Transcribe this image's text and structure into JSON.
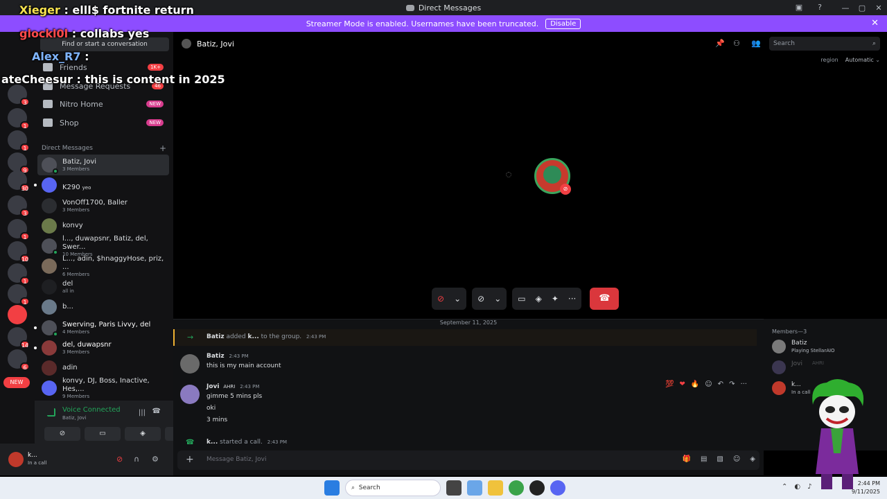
{
  "window": {
    "title": "Direct Messages"
  },
  "banner": {
    "text": "Streamer Mode is enabled. Usernames have been truncated.",
    "button": "Disable"
  },
  "stream_chat": [
    {
      "name": "Xieger",
      "text": ": elll$ fortnite return"
    },
    {
      "name": "glockl0l",
      "text": ": collabs yes"
    },
    {
      "name": "Alex_R7",
      "text": ":"
    },
    {
      "name": "ateCheesur",
      "text": ": this is content in 2025"
    }
  ],
  "servers": {
    "badges": [
      "3",
      "1",
      "1",
      "9",
      "30",
      "3",
      "1",
      "10",
      "1",
      "1",
      "14",
      "6"
    ],
    "new_label": "NEW"
  },
  "sidebar": {
    "find": "Find or start a conversation",
    "nav": [
      {
        "label": "Friends",
        "pill": "1K+"
      },
      {
        "label": "Message Requests",
        "pill": "46"
      },
      {
        "label": "Nitro Home",
        "pill": "NEW"
      },
      {
        "label": "Shop",
        "pill": "NEW"
      }
    ],
    "dm_header": "Direct Messages",
    "dms": [
      {
        "name": "Batiz, Jovi",
        "sub": "3 Members"
      },
      {
        "name": "K290",
        "sub": "",
        "tag": "yeo"
      },
      {
        "name": "VonOff1700, Baller",
        "sub": "3 Members"
      },
      {
        "name": "konvy",
        "sub": ""
      },
      {
        "name": "l..., duwapsnr, Batiz, del, Swer...",
        "sub": "10 Members"
      },
      {
        "name": "L..., adin, $hnaggyHose, priz, ...",
        "sub": "6 Members"
      },
      {
        "name": "del",
        "sub": "all in"
      },
      {
        "name": "b...",
        "sub": ""
      },
      {
        "name": "Swerving, Paris Livvy, del",
        "sub": "4 Members"
      },
      {
        "name": "del, duwapsnr",
        "sub": "3 Members"
      },
      {
        "name": "adin",
        "sub": ""
      },
      {
        "name": "konvy, DJ, Boss, Inactive, Hes,...",
        "sub": "9 Members"
      }
    ]
  },
  "voice": {
    "title": "Voice Connected",
    "channel": "Batiz, Jovi"
  },
  "user": {
    "name": "k...",
    "status": "In a call"
  },
  "channel": {
    "title": "Batiz, Jovi",
    "search_placeholder": "Search",
    "region_label": "region",
    "region_value": "Automatic"
  },
  "chat": {
    "date": "September 11, 2025",
    "system": {
      "actor": "Batiz",
      "verb": "added",
      "target": "k...",
      "rest": "to the group.",
      "time": "2:43 PM"
    },
    "messages": [
      {
        "author": "Batiz",
        "time": "2:43 PM",
        "lines": [
          "this is my main account"
        ]
      },
      {
        "author": "Jovi",
        "tag": "AHRI",
        "time": "2:43 PM",
        "lines": [
          "gimme 5 mins pls",
          "oki",
          "3 mins"
        ]
      }
    ],
    "call_event": {
      "actor": "k...",
      "text": "started a call.",
      "time": "2:43 PM"
    },
    "input_placeholder": "Message Batiz, Jovi"
  },
  "members": {
    "header": "Members—3",
    "list": [
      {
        "name": "Batiz",
        "activity": "Playing StellarAIO"
      },
      {
        "name": "Jovi",
        "activity": "AHRI"
      },
      {
        "name": "k...",
        "activity": "In a call"
      }
    ]
  },
  "taskbar": {
    "search": "Search",
    "time": "2:44 PM",
    "date": "9/11/2025"
  }
}
